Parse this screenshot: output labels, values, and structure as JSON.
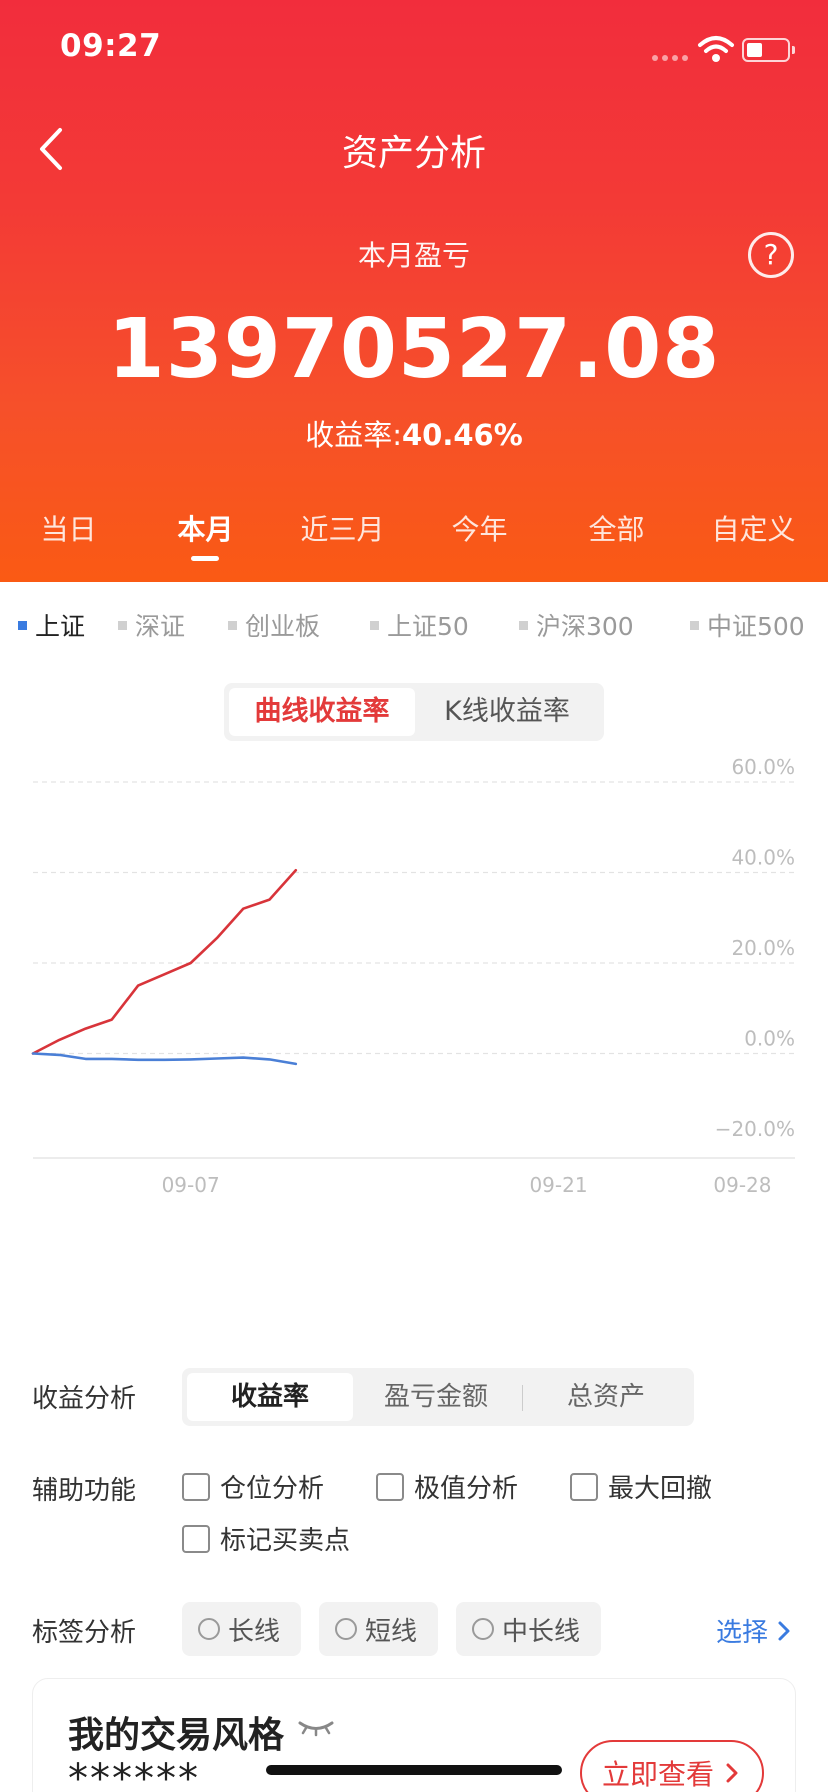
{
  "status_bar": {
    "time": "09:27"
  },
  "header": {
    "title": "资产分析",
    "pnl_label": "本月盈亏",
    "pnl_value": "13970527.08",
    "rate_label": "收益率:",
    "rate_value": "40.46%",
    "help_symbol": "?"
  },
  "period_tabs": [
    {
      "label": "当日",
      "active": false
    },
    {
      "label": "本月",
      "active": true
    },
    {
      "label": "近三月",
      "active": false
    },
    {
      "label": "今年",
      "active": false
    },
    {
      "label": "全部",
      "active": false
    },
    {
      "label": "自定义",
      "active": false
    }
  ],
  "index_tabs": [
    {
      "label": "上证",
      "active": true
    },
    {
      "label": "深证",
      "active": false
    },
    {
      "label": "创业板",
      "active": false
    },
    {
      "label": "上证50",
      "active": false
    },
    {
      "label": "沪深300",
      "active": false
    },
    {
      "label": "中证500",
      "active": false
    }
  ],
  "chart_toggle": {
    "options": [
      "曲线收益率",
      "K线收益率"
    ],
    "active_index": 0
  },
  "chart_data": {
    "type": "line",
    "title": "",
    "xlabel": "",
    "ylabel": "",
    "ylim": [
      -20,
      60
    ],
    "y_ticks": [
      "60.0%",
      "40.0%",
      "20.0%",
      "0.0%",
      "−20.0%"
    ],
    "x_ticks": [
      "09-07",
      "09-21",
      "09-28"
    ],
    "x_range": [
      "09-01",
      "09-30"
    ],
    "grid": true,
    "series": [
      {
        "color": "#d8343a",
        "points": [
          [
            "09-01",
            0
          ],
          [
            "09-02",
            3
          ],
          [
            "09-03",
            5.5
          ],
          [
            "09-04",
            7.5
          ],
          [
            "09-05",
            15
          ],
          [
            "09-06",
            17.5
          ],
          [
            "09-07",
            20
          ],
          [
            "09-08",
            25.5
          ],
          [
            "09-09",
            32
          ],
          [
            "09-10",
            34
          ],
          [
            "09-11",
            40.5
          ]
        ]
      },
      {
        "color": "#4a7fd6",
        "points": [
          [
            "09-01",
            0
          ],
          [
            "09-02",
            -0.3
          ],
          [
            "09-03",
            -1.2
          ],
          [
            "09-04",
            -1.2
          ],
          [
            "09-05",
            -1.4
          ],
          [
            "09-06",
            -1.4
          ],
          [
            "09-07",
            -1.3
          ],
          [
            "09-08",
            -1.1
          ],
          [
            "09-09",
            -0.9
          ],
          [
            "09-10",
            -1.3
          ],
          [
            "09-11",
            -2.3
          ]
        ]
      }
    ]
  },
  "analysis": {
    "label": "收益分析",
    "options": [
      "收益率",
      "盈亏金额",
      "总资产"
    ],
    "active_index": 0
  },
  "aux": {
    "label": "辅助功能",
    "items": [
      "仓位分析",
      "极值分析",
      "最大回撤",
      "标记买卖点"
    ]
  },
  "tags": {
    "label": "标签分析",
    "items": [
      "长线",
      "短线",
      "中长线"
    ],
    "select_label": "选择"
  },
  "trading_style": {
    "title": "我的交易风格",
    "masked_value": "******",
    "button_label": "立即查看"
  },
  "colors": {
    "accent_red": "#e33a3a",
    "link_blue": "#3a7be0"
  }
}
